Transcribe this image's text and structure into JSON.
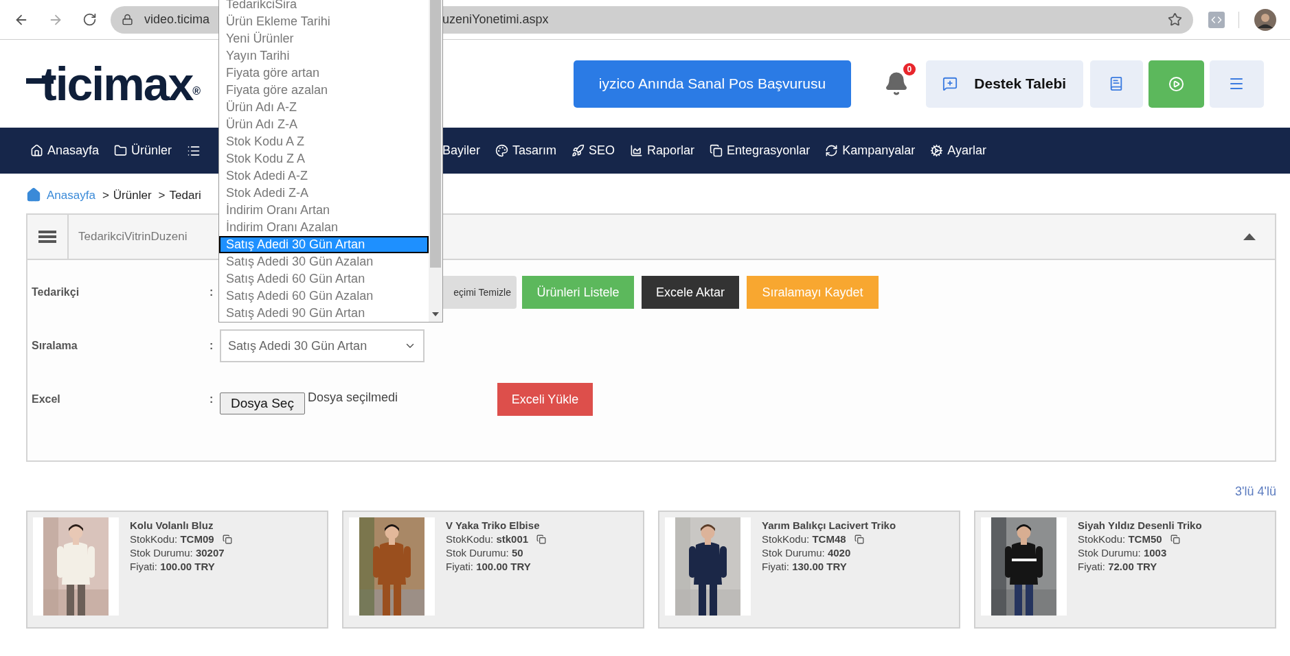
{
  "browser": {
    "url_start": "video.ticima",
    "url_end": "uzeniYonetimi.aspx"
  },
  "header": {
    "logo": "ticimax",
    "logo_mark": "®",
    "pos_button": "iyzico Anında Sanal Pos Başvurusu",
    "notification_count": "0",
    "support_button": "Destek Talebi"
  },
  "nav": [
    {
      "label": "Anasayfa"
    },
    {
      "label": "Ürünler"
    },
    {
      "label": "Bayiler"
    },
    {
      "label": "Tasarım"
    },
    {
      "label": "SEO"
    },
    {
      "label": "Raporlar"
    },
    {
      "label": "Entegrasyonlar"
    },
    {
      "label": "Kampanyalar"
    },
    {
      "label": "Ayarlar"
    }
  ],
  "breadcrumb": {
    "separator": ">",
    "items": [
      "Anasayfa",
      "Ürünler",
      "Tedari"
    ]
  },
  "panel": {
    "title": "TedarikciVitrinDuzeni"
  },
  "form": {
    "rows": [
      {
        "label": "Tedarikçi",
        "colon": ":"
      },
      {
        "label": "Sıralama",
        "colon": ":"
      },
      {
        "label": "Excel",
        "colon": ":"
      }
    ],
    "clear_button": "eçimi Temizle",
    "list_button": "Ürünleri Listele",
    "export_button": "Excele Aktar",
    "save_button": "Sıralamayı Kaydet",
    "sort_value": "Satış Adedi 30 Gün Artan",
    "file_button": "Dosya Seç",
    "file_status": "Dosya seçilmedi",
    "upload_button": "Exceli Yükle"
  },
  "sort_dropdown": {
    "options": [
      {
        "label": "TedarikciSira",
        "selected": false
      },
      {
        "label": "Ürün Ekleme Tarihi",
        "selected": false
      },
      {
        "label": "Yeni Ürünler",
        "selected": false
      },
      {
        "label": "Yayın Tarihi",
        "selected": false
      },
      {
        "label": "Fiyata göre artan",
        "selected": false
      },
      {
        "label": "Fiyata göre azalan",
        "selected": false
      },
      {
        "label": "Ürün Adı A-Z",
        "selected": false
      },
      {
        "label": "Ürün Adı Z-A",
        "selected": false
      },
      {
        "label": "Stok Kodu A Z",
        "selected": false
      },
      {
        "label": "Stok Kodu Z A",
        "selected": false
      },
      {
        "label": "Stok Adedi A-Z",
        "selected": false
      },
      {
        "label": "Stok Adedi Z-A",
        "selected": false
      },
      {
        "label": "İndirim Oranı Artan",
        "selected": false
      },
      {
        "label": "İndirim Oranı Azalan",
        "selected": false
      },
      {
        "label": "Satış Adedi 30 Gün Artan",
        "selected": true
      },
      {
        "label": "Satış Adedi 30 Gün Azalan",
        "selected": false
      },
      {
        "label": "Satış Adedi 60 Gün Artan",
        "selected": false
      },
      {
        "label": "Satış Adedi 60 Gün Azalan",
        "selected": false
      },
      {
        "label": "Satış Adedi 90 Gün Artan",
        "selected": false
      }
    ]
  },
  "layout_links": [
    "3'lü",
    "4'lü"
  ],
  "products": [
    {
      "name": "Kolu Volanlı Bluz",
      "code_label": "StokKodu:",
      "code": "TCM09",
      "stock_label": "Stok Durumu:",
      "stock": "30207",
      "price_label": "Fiyati:",
      "price": "100.00 TRY"
    },
    {
      "name": "V Yaka Triko Elbise",
      "code_label": "StokKodu:",
      "code": "stk001",
      "stock_label": "Stok Durumu:",
      "stock": "50",
      "price_label": "Fiyati:",
      "price": "100.00 TRY"
    },
    {
      "name": "Yarım Balıkçı Lacivert Triko",
      "code_label": "StokKodu:",
      "code": "TCM48",
      "stock_label": "Stok Durumu:",
      "stock": "4020",
      "price_label": "Fiyati:",
      "price": "130.00 TRY"
    },
    {
      "name": "Siyah Yıldız Desenli Triko",
      "code_label": "StokKodu:",
      "code": "TCM50",
      "stock_label": "Stok Durumu:",
      "stock": "1003",
      "price_label": "Fiyati:",
      "price": "72.00 TRY"
    }
  ]
}
